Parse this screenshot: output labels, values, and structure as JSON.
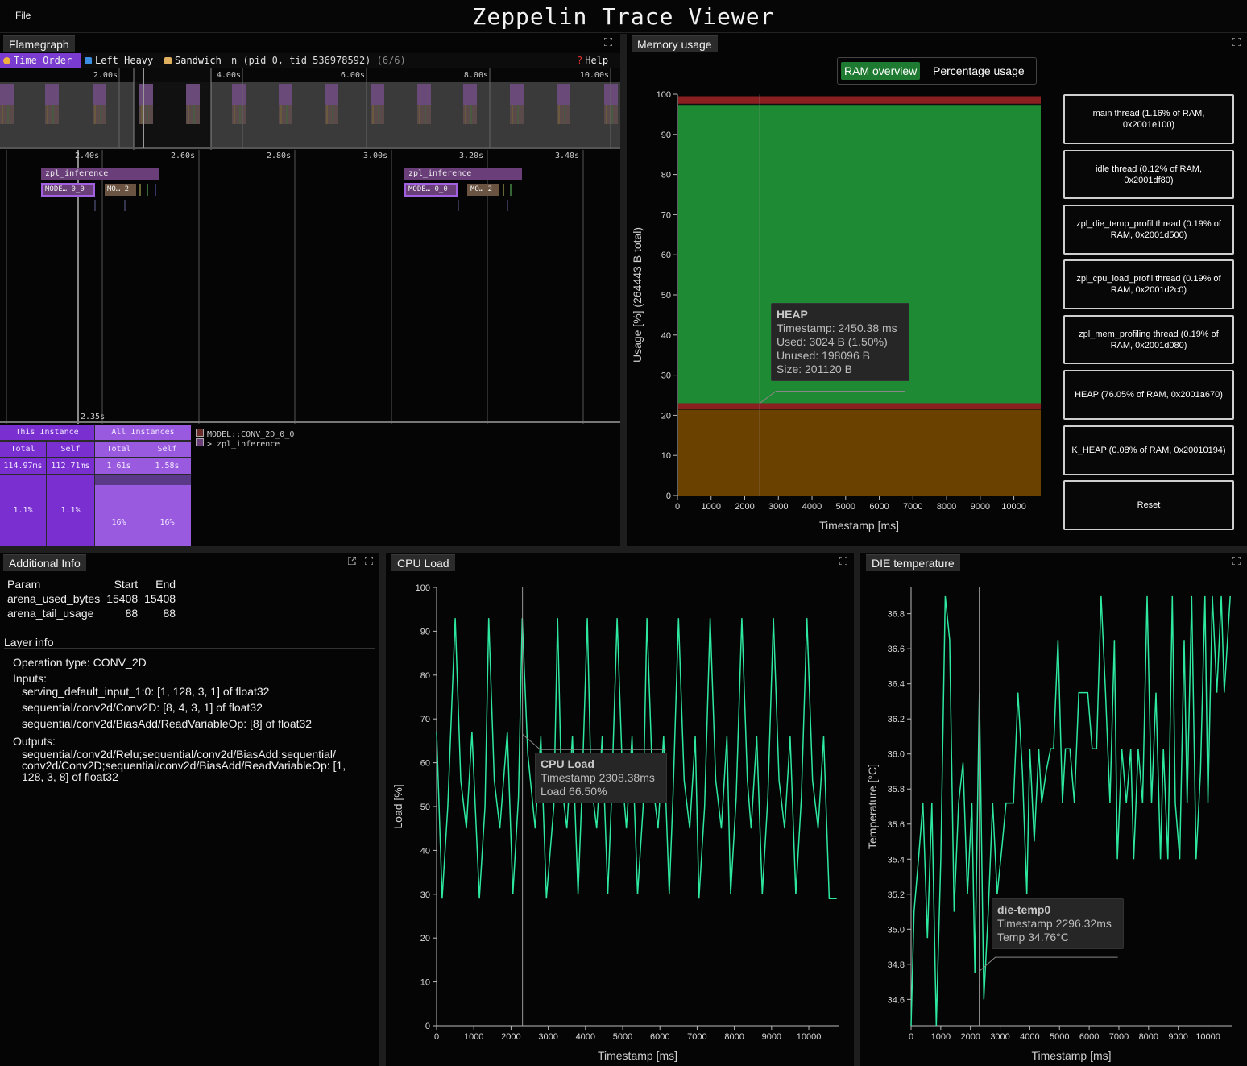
{
  "app": {
    "title": "Zeppelin Trace Viewer",
    "file_menu": "File"
  },
  "flamegraph": {
    "tab": "Flamegraph",
    "toolbar": {
      "time_order": "Time Order",
      "left_heavy": "Left Heavy",
      "sandwich": "Sandwich",
      "thread_label": "n (pid 0, tid 536978592)",
      "thread_count": "(6/6)",
      "help": "Help"
    },
    "overview_ticks": [
      "2.00s",
      "4.00s",
      "6.00s",
      "8.00s",
      "10.00s"
    ],
    "detail_ticks": [
      "2.40s",
      "2.60s",
      "2.80s",
      "3.00s",
      "3.20s",
      "3.40s"
    ],
    "cursor_time": "2.35s",
    "frames": {
      "inference": "zpl_inference",
      "model_a": "MODE… 0_0",
      "model_b": "MO… 2"
    },
    "stats": {
      "this_instance": "This Instance",
      "all_instances": "All Instances",
      "total": "Total",
      "self": "Self",
      "values": [
        "114.97ms",
        "112.71ms",
        "1.61s",
        "1.58s"
      ],
      "percents": [
        "1.1%",
        "1.1%",
        "16%",
        "16%"
      ]
    },
    "legend": {
      "model": "MODEL::CONV_2D_0_0",
      "parent": "> zpl_inference"
    },
    "colors": {
      "accent": "#7a3bd0",
      "frame": "#6a3e78"
    }
  },
  "memory": {
    "tab": "Memory usage",
    "tabs": {
      "ram_overview": "RAM overview",
      "percentage": "Percentage usage"
    },
    "legend_items": [
      "main thread (1.16% of RAM, 0x2001e100)",
      "idle thread (0.12% of RAM, 0x2001df80)",
      "zpl_die_temp_profil thread (0.19% of RAM, 0x2001d500)",
      "zpl_cpu_load_profil thread (0.19% of RAM, 0x2001d2c0)",
      "zpl_mem_profiling thread (0.19% of RAM, 0x2001d080)",
      "HEAP (76.05% of RAM, 0x2001a670)",
      "K_HEAP (0.08% of RAM, 0x20010194)"
    ],
    "reset": "Reset",
    "tooltip": {
      "title": "HEAP",
      "timestamp": "Timestamp: 2450.38 ms",
      "used": "Used: 3024 B (1.50%)",
      "unused": "Unused: 198096 B",
      "size": "Size: 201120 B"
    },
    "chart_data": {
      "type": "area",
      "xlabel": "Timestamp [ms]",
      "ylabel": "Usage [%] (264443 B total)",
      "xlim": [
        0,
        10800
      ],
      "ylim": [
        0,
        100
      ],
      "x_ticks": [
        0,
        1000,
        2000,
        3000,
        4000,
        5000,
        6000,
        7000,
        8000,
        9000,
        10000
      ],
      "y_ticks": [
        0,
        10,
        20,
        30,
        40,
        50,
        60,
        70,
        80,
        90,
        100
      ],
      "series": [
        {
          "color": "#6b4100",
          "from": 0,
          "to": 21.5
        },
        {
          "color": "#8b2020",
          "from": 21.5,
          "to": 23.0
        },
        {
          "color": "#1e8a33",
          "from": 23.0,
          "to": 97.5
        },
        {
          "color": "#8b2020",
          "from": 97.5,
          "to": 99.5
        }
      ],
      "cursor_x": 2450
    }
  },
  "info": {
    "tab": "Additional Info",
    "headers": [
      "Param",
      "Start",
      "End"
    ],
    "rows": [
      [
        "arena_used_bytes",
        "15408",
        "15408"
      ],
      [
        "arena_tail_usage",
        "88",
        "88"
      ]
    ],
    "layer_info": "Layer info",
    "operation": "Operation type: CONV_2D",
    "inputs_label": "Inputs:",
    "inputs": [
      "serving_default_input_1:0: [1, 128, 3, 1] of float32",
      "sequential/conv2d/Conv2D: [8, 4, 3, 1] of float32",
      "sequential/conv2d/BiasAdd/ReadVariableOp: [8] of float32"
    ],
    "outputs_label": "Outputs:",
    "outputs": [
      "sequential/conv2d/Relu;sequential/conv2d/BiasAdd;sequential/",
      "conv2d/Conv2D;sequential/conv2d/BiasAdd/ReadVariableOp: [1,",
      "128, 3, 8] of float32"
    ]
  },
  "cpu": {
    "tab": "CPU Load",
    "tooltip": {
      "title": "CPU Load",
      "timestamp": "Timestamp 2308.38ms",
      "value": "Load 66.50%"
    },
    "chart_data": {
      "type": "line",
      "xlabel": "Timestamp [ms]",
      "ylabel": "Load [%]",
      "xlim": [
        0,
        10800
      ],
      "ylim": [
        0,
        100
      ],
      "x_ticks": [
        0,
        1000,
        2000,
        3000,
        4000,
        5000,
        6000,
        7000,
        8000,
        9000,
        10000
      ],
      "y_ticks": [
        0,
        10,
        20,
        30,
        40,
        50,
        60,
        70,
        80,
        90,
        100
      ],
      "color": "#2ee8a0",
      "x": [
        0,
        150,
        300,
        500,
        650,
        800,
        950,
        1150,
        1300,
        1400,
        1550,
        1700,
        1900,
        2050,
        2200,
        2300,
        2450,
        2650,
        2800,
        2950,
        3150,
        3250,
        3350,
        3500,
        3650,
        3800,
        3900,
        4050,
        4150,
        4300,
        4450,
        4600,
        4700,
        4850,
        5000,
        5100,
        5250,
        5400,
        5550,
        5650,
        5800,
        5950,
        6100,
        6250,
        6350,
        6500,
        6650,
        6800,
        6950,
        7050,
        7200,
        7350,
        7500,
        7650,
        7800,
        7900,
        8050,
        8200,
        8350,
        8450,
        8600,
        8750,
        8900,
        9050,
        9200,
        9350,
        9500,
        9650,
        9800,
        9950,
        10100,
        10250,
        10400,
        10550,
        10750
      ],
      "y": [
        67,
        29,
        50,
        93,
        56,
        45,
        67,
        29,
        50,
        93,
        56,
        45,
        67,
        30,
        52,
        93,
        62,
        45,
        66,
        29,
        50,
        93,
        56,
        45,
        66,
        30,
        52,
        93,
        56,
        45,
        66,
        30,
        52,
        93,
        56,
        45,
        66,
        30,
        50,
        93,
        56,
        45,
        66,
        30,
        52,
        93,
        56,
        45,
        66,
        29,
        50,
        93,
        56,
        45,
        66,
        30,
        52,
        93,
        56,
        45,
        66,
        30,
        52,
        93,
        56,
        45,
        66,
        30,
        52,
        93,
        56,
        45,
        66,
        29,
        29
      ],
      "cursor_x": 2308
    }
  },
  "temp": {
    "tab": "DIE temperature",
    "tooltip": {
      "title": "die-temp0",
      "timestamp": "Timestamp 2296.32ms",
      "value": "Temp 34.76°C"
    },
    "chart_data": {
      "type": "line",
      "xlabel": "Timestamp [ms]",
      "ylabel": "Temperature [°C]",
      "xlim": [
        0,
        10800
      ],
      "ylim": [
        34.45,
        36.95
      ],
      "x_ticks": [
        0,
        1000,
        2000,
        3000,
        4000,
        5000,
        6000,
        7000,
        8000,
        9000,
        10000
      ],
      "y_ticks": [
        34.6,
        34.8,
        35.0,
        35.2,
        35.4,
        35.6,
        35.8,
        36.0,
        36.2,
        36.4,
        36.6,
        36.8
      ],
      "y_tick_labels": [
        "34.6",
        "34.8",
        "35.0",
        "35.2",
        "35.4",
        "35.6",
        "35.8",
        "36.0",
        "36.2",
        "36.4",
        "36.6",
        "36.8"
      ],
      "color": "#2ee8a0",
      "x": [
        0,
        100,
        250,
        400,
        550,
        700,
        850,
        1000,
        1150,
        1300,
        1450,
        1600,
        1750,
        1900,
        2050,
        2150,
        2300,
        2450,
        2600,
        2750,
        2900,
        3050,
        3200,
        3300,
        3450,
        3600,
        3750,
        3900,
        4000,
        4150,
        4300,
        4400,
        4550,
        4700,
        4800,
        4950,
        5100,
        5200,
        5350,
        5500,
        5650,
        5800,
        5950,
        6100,
        6250,
        6400,
        6550,
        6700,
        6850,
        6950,
        7100,
        7250,
        7400,
        7500,
        7650,
        7800,
        7950,
        8100,
        8250,
        8400,
        8500,
        8650,
        8800,
        8900,
        9050,
        9200,
        9300,
        9450,
        9600,
        9750,
        9900,
        10000,
        10150,
        10300,
        10450,
        10550,
        10750
      ],
      "y": [
        34.45,
        35.1,
        35.4,
        35.72,
        34.95,
        35.72,
        34.45,
        35.4,
        36.9,
        36.65,
        35.1,
        35.72,
        35.95,
        35.2,
        35.72,
        34.75,
        36.35,
        34.6,
        35.1,
        35.72,
        35.2,
        35.45,
        35.72,
        35.72,
        35.72,
        36.35,
        35.9,
        35.2,
        36.03,
        35.5,
        36.03,
        35.72,
        35.9,
        36.03,
        36.03,
        36.65,
        35.72,
        36.03,
        36.03,
        35.72,
        36.35,
        36.35,
        36.35,
        36.03,
        36.03,
        36.9,
        36.35,
        35.72,
        36.65,
        35.4,
        36.03,
        35.72,
        36.03,
        35.4,
        36.03,
        35.72,
        36.9,
        35.72,
        36.35,
        35.4,
        36.03,
        35.4,
        36.9,
        35.72,
        35.4,
        36.65,
        35.72,
        36.9,
        35.4,
        35.9,
        36.9,
        35.72,
        36.9,
        36.35,
        36.9,
        36.35,
        36.9
      ],
      "cursor_x": 2296
    }
  }
}
